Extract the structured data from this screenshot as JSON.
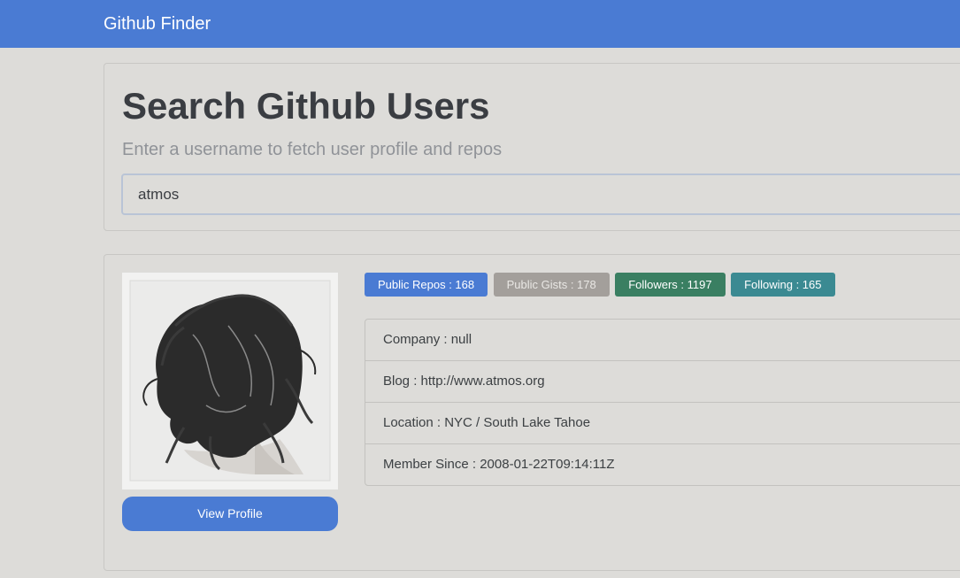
{
  "navbar": {
    "brand": "Github Finder",
    "color": "#4a7bd3"
  },
  "search": {
    "heading": "Search Github Users",
    "lead": "Enter a username to fetch user profile and repos",
    "value": "atmos"
  },
  "profile": {
    "avatar_icon": "user-avatar-photo",
    "view_profile_label": "View Profile",
    "badges": {
      "public_repos": "Public Repos : 168",
      "public_gists": "Public Gists : 178",
      "followers": "Followers : 1197",
      "following": "Following : 165"
    },
    "info": {
      "company": "Company : null",
      "blog": "Blog : http://www.atmos.org",
      "location": "Location : NYC / South Lake Tahoe",
      "member_since": "Member Since : 2008-01-22T09:14:11Z"
    }
  },
  "colors": {
    "accent": "#4a7bd3",
    "gists": "#a39f9b",
    "followers": "#3a7f62",
    "following": "#3b8a92",
    "background": "#dddcd9"
  }
}
